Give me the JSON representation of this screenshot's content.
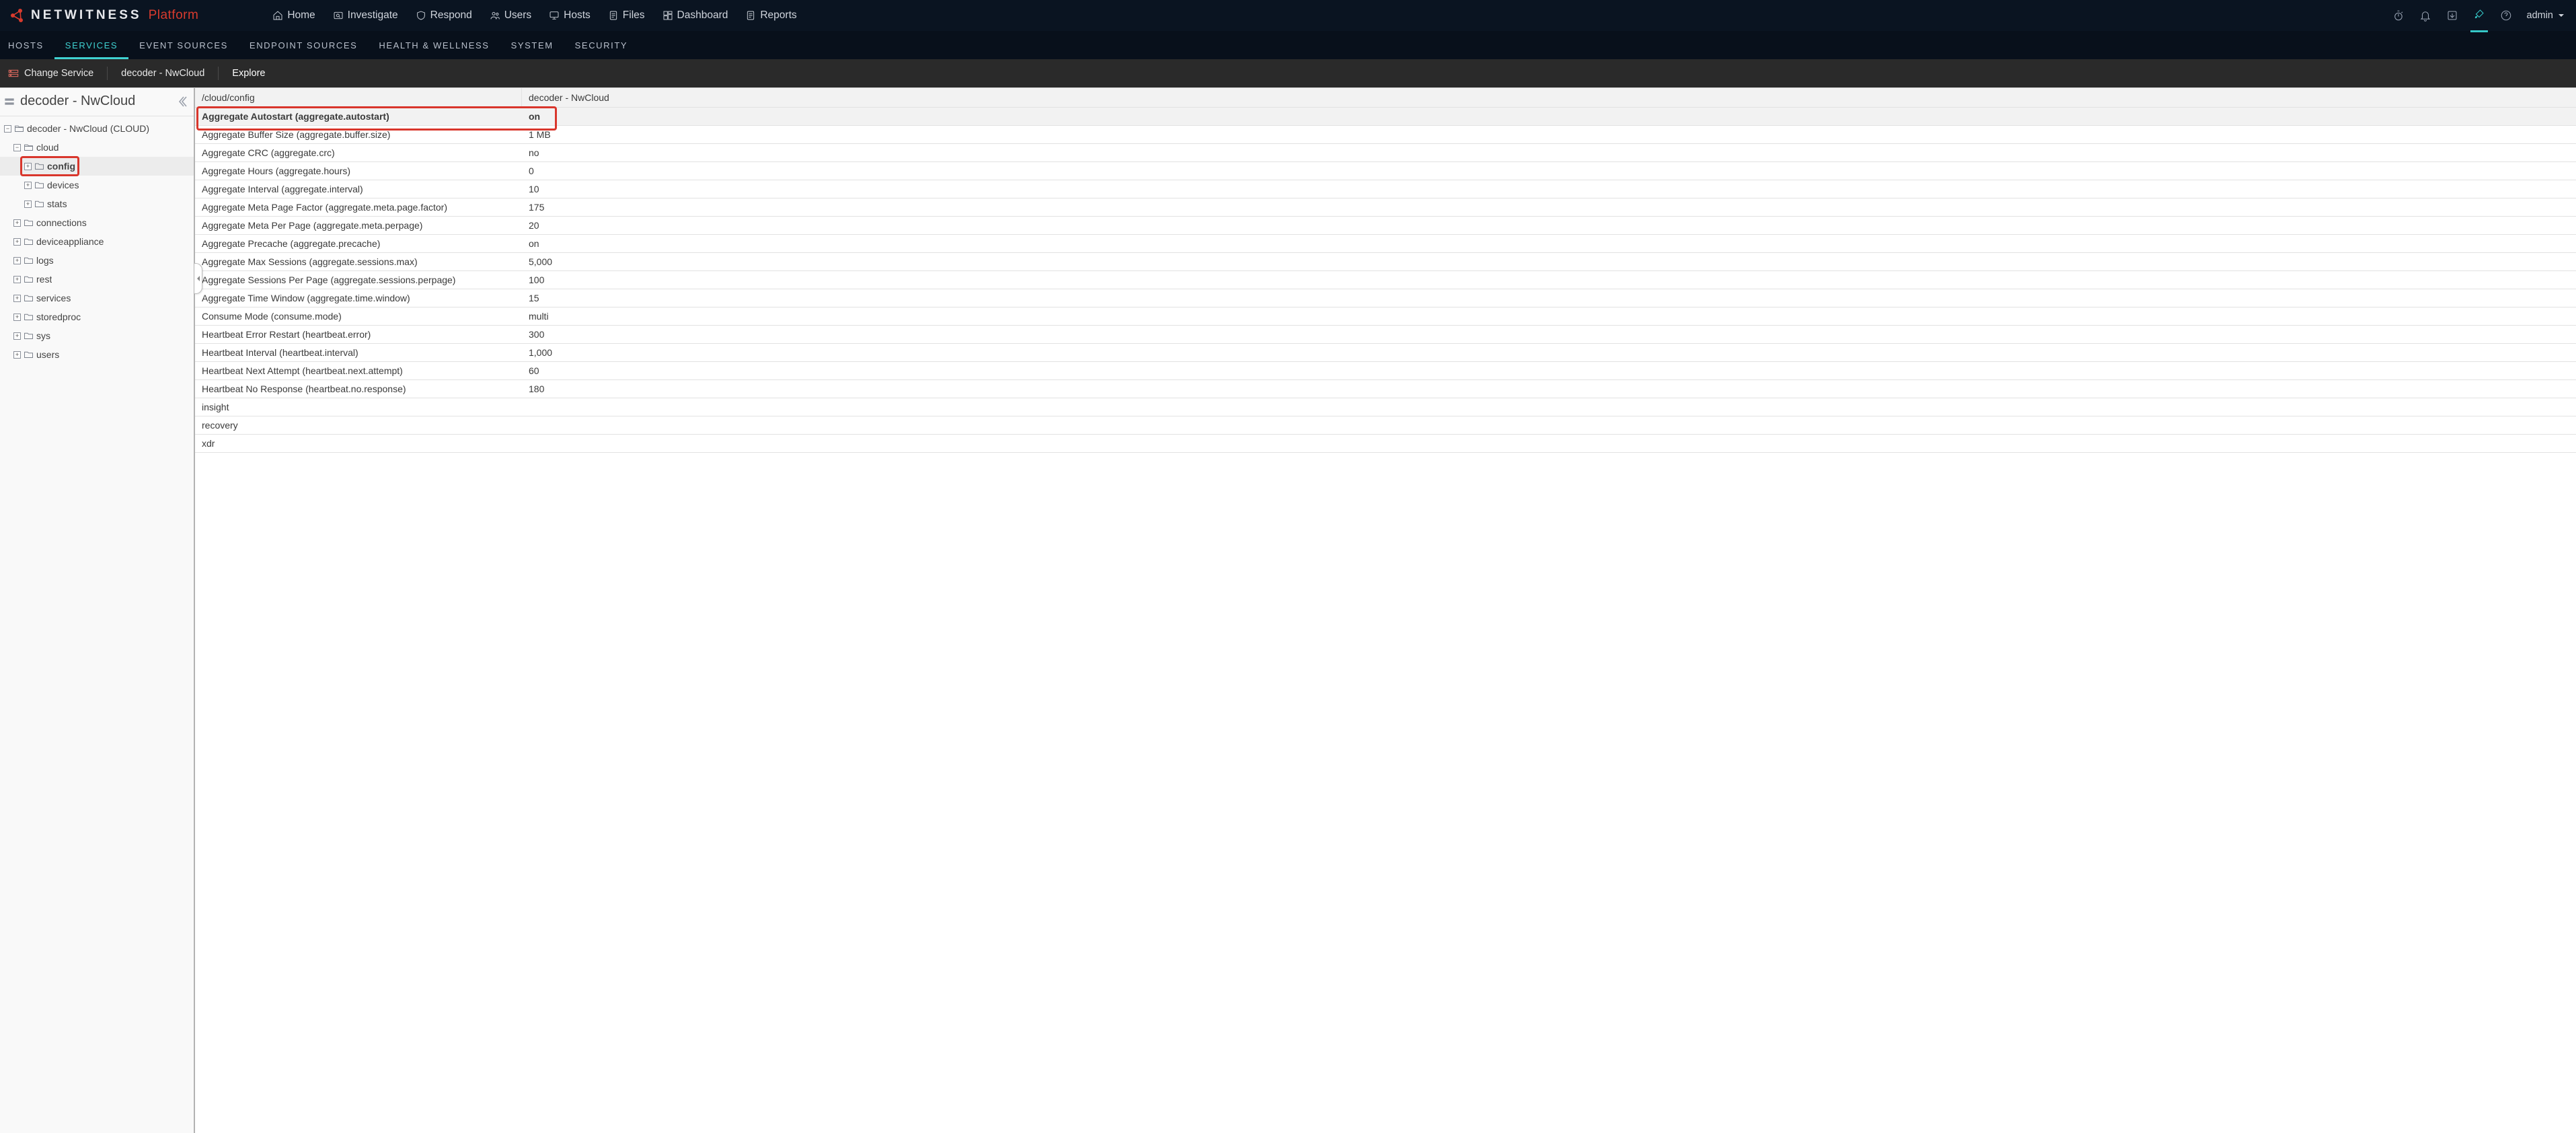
{
  "brand": {
    "name": "NETWITNESS",
    "suffix": "Platform"
  },
  "topnav": {
    "home": "Home",
    "investigate": "Investigate",
    "respond": "Respond",
    "users": "Users",
    "hosts": "Hosts",
    "files": "Files",
    "dashboard": "Dashboard",
    "reports": "Reports"
  },
  "user": {
    "name": "admin"
  },
  "subnav": {
    "hosts": "HOSTS",
    "services": "SERVICES",
    "event_sources": "EVENT SOURCES",
    "endpoint_sources": "ENDPOINT SOURCES",
    "health": "HEALTH & WELLNESS",
    "system": "SYSTEM",
    "security": "SECURITY"
  },
  "context": {
    "change_service": "Change Service",
    "crumb_service": "decoder - NwCloud",
    "crumb_action": "Explore"
  },
  "sidebar": {
    "title": "decoder - NwCloud",
    "nodes": {
      "root": "decoder - NwCloud (CLOUD)",
      "cloud": "cloud",
      "config": "config",
      "devices": "devices",
      "stats": "stats",
      "connections": "connections",
      "deviceappliance": "deviceappliance",
      "logs": "logs",
      "rest": "rest",
      "services": "services",
      "storedproc": "storedproc",
      "sys": "sys",
      "users": "users"
    }
  },
  "grid": {
    "header_path": "/cloud/config",
    "header_service": "decoder - NwCloud",
    "rows": [
      {
        "key": "Aggregate Autostart (aggregate.autostart)",
        "value": "on",
        "highlight": true
      },
      {
        "key": "Aggregate Buffer Size (aggregate.buffer.size)",
        "value": "1 MB"
      },
      {
        "key": "Aggregate CRC (aggregate.crc)",
        "value": "no"
      },
      {
        "key": "Aggregate Hours (aggregate.hours)",
        "value": "0"
      },
      {
        "key": "Aggregate Interval (aggregate.interval)",
        "value": "10"
      },
      {
        "key": "Aggregate Meta Page Factor (aggregate.meta.page.factor)",
        "value": "175"
      },
      {
        "key": "Aggregate Meta Per Page (aggregate.meta.perpage)",
        "value": "20"
      },
      {
        "key": "Aggregate Precache (aggregate.precache)",
        "value": "on"
      },
      {
        "key": "Aggregate Max Sessions (aggregate.sessions.max)",
        "value": "5,000"
      },
      {
        "key": "Aggregate Sessions Per Page (aggregate.sessions.perpage)",
        "value": "100"
      },
      {
        "key": "Aggregate Time Window (aggregate.time.window)",
        "value": "15"
      },
      {
        "key": "Consume Mode (consume.mode)",
        "value": "multi"
      },
      {
        "key": "Heartbeat Error Restart (heartbeat.error)",
        "value": "300"
      },
      {
        "key": "Heartbeat Interval (heartbeat.interval)",
        "value": "1,000"
      },
      {
        "key": "Heartbeat Next Attempt (heartbeat.next.attempt)",
        "value": "60"
      },
      {
        "key": "Heartbeat No Response (heartbeat.no.response)",
        "value": "180"
      },
      {
        "key": "insight",
        "value": ""
      },
      {
        "key": "recovery",
        "value": ""
      },
      {
        "key": "xdr",
        "value": ""
      }
    ]
  }
}
